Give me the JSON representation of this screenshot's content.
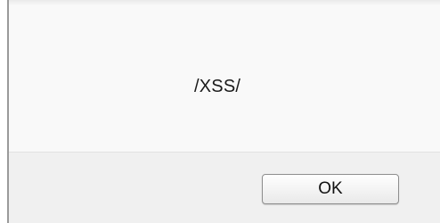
{
  "dialog": {
    "message": "/XSS/",
    "ok_label": "OK"
  },
  "colors": {
    "background": "#f9f9f9",
    "footer": "#f0f0f0",
    "border": "#9a9a9a"
  }
}
